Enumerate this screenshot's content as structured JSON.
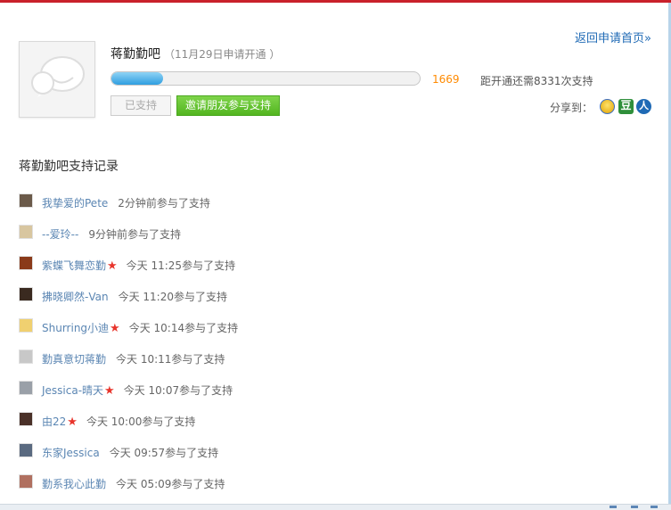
{
  "colors": {
    "link": "#1f6ab5",
    "name_link": "#5b86b3",
    "count": "#ff8a00",
    "invite_button": "#62bf2e",
    "star": "#e8352c"
  },
  "header": {
    "avatar_icon": "speech-bubble-placeholder-icon",
    "bar_name": "蒋勤勤吧",
    "apply_note": "（11月29日申请开通 ）",
    "back_link": "返回申请首页»"
  },
  "progress": {
    "count": "1669",
    "fraction": 0.167,
    "remaining_text": "距开通还需8331次支持"
  },
  "buttons": {
    "supported": "已支持",
    "invite": "邀请朋友参与支持"
  },
  "share": {
    "label": "分享到：",
    "icons": [
      "qzone-icon",
      "douban-icon",
      "renren-icon"
    ],
    "douban_glyph": "豆",
    "renren_glyph": "人"
  },
  "records_title": "蒋勤勤吧支持记录",
  "records": [
    {
      "name": "我挚爱的Pete",
      "star": "",
      "time": "2分钟前参与了支持",
      "face_color": "#6b5a4a"
    },
    {
      "name": "--爱玲--",
      "star": "",
      "time": "9分钟前参与了支持",
      "face_color": "#d8c6a0"
    },
    {
      "name": "紫蝶飞舞恋勤",
      "star": "★",
      "time": "今天  11:25参与了支持",
      "face_color": "#8a3a1a"
    },
    {
      "name": "拂晓卿然-Van",
      "star": "",
      "time": "今天  11:20参与了支持",
      "face_color": "#3a2a20"
    },
    {
      "name": "Shurring小迪",
      "star": "★",
      "time": "今天  10:14参与了支持",
      "face_color": "#f0d070"
    },
    {
      "name": "勤真意切蒋勤",
      "star": "",
      "time": "今天  10:11参与了支持",
      "face_color": "#c8c8c8"
    },
    {
      "name": "Jessica-晴天",
      "star": "★",
      "time": "今天  10:07参与了支持",
      "face_color": "#9aa0a8"
    },
    {
      "name": "由22",
      "star": "★",
      "time": "今天  10:00参与了支持",
      "face_color": "#4a3028"
    },
    {
      "name": "东家Jessica",
      "star": "",
      "time": "今天  09:57参与了支持",
      "face_color": "#5a6a80"
    },
    {
      "name": "勤系我心此勤",
      "star": "",
      "time": "今天  05:09参与了支持",
      "face_color": "#b07060"
    }
  ]
}
